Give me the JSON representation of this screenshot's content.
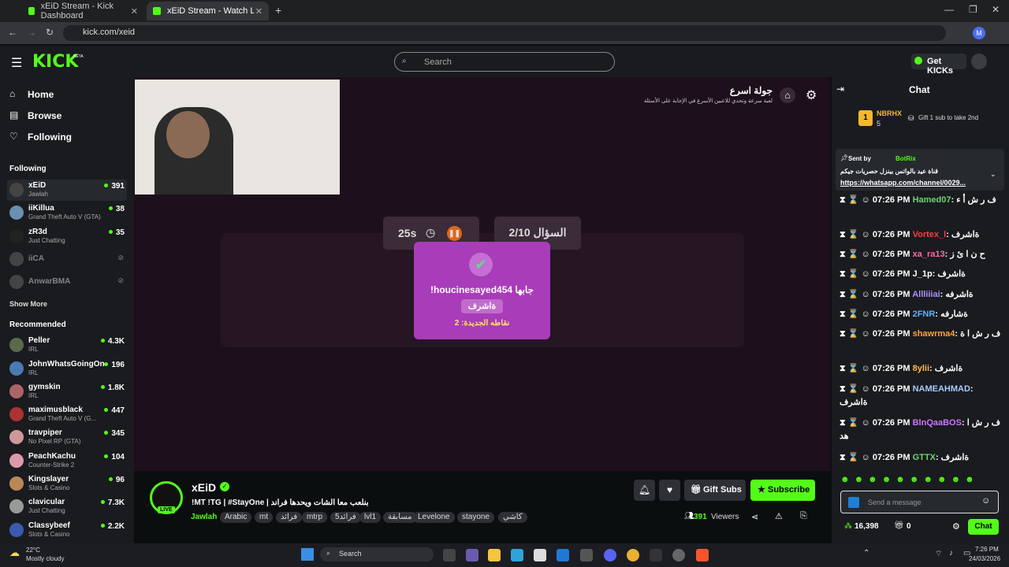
{
  "browser": {
    "tabs": [
      {
        "title": "xEiD Stream - Kick Dashboard"
      },
      {
        "title": "xEiD Stream - Watch Live o"
      }
    ],
    "url": "kick.com/xeid",
    "profile_initial": "M"
  },
  "header": {
    "logo": "KICK",
    "logo_badge": "BETA",
    "search_placeholder": "Search",
    "get_kicks": "Get KICKs"
  },
  "sidebar": {
    "nav": [
      {
        "label": "Home",
        "icon": "home-icon"
      },
      {
        "label": "Browse",
        "icon": "compass-icon"
      },
      {
        "label": "Following",
        "icon": "heart-icon"
      }
    ],
    "following_title": "Following",
    "following": [
      {
        "name": "xEiD",
        "category": "Jawlah",
        "viewers": "391"
      },
      {
        "name": "iiKillua",
        "category": "Grand Theft Auto V (GTA)",
        "viewers": "38"
      },
      {
        "name": "zR3d",
        "category": "Just Chatting",
        "viewers": "35"
      },
      {
        "name": "iiCA",
        "category": "",
        "viewers": ""
      },
      {
        "name": "AnwarBMA",
        "category": "",
        "viewers": ""
      }
    ],
    "show_more": "Show More",
    "recommended_title": "Recommended",
    "recommended": [
      {
        "name": "Peller",
        "category": "IRL",
        "viewers": "4.3K"
      },
      {
        "name": "JohnWhatsGoingOn",
        "category": "IRL",
        "viewers": "196"
      },
      {
        "name": "gymskin",
        "category": "IRL",
        "viewers": "1.8K"
      },
      {
        "name": "maximusblack",
        "category": "Grand Theft Auto V (G...",
        "viewers": "447"
      },
      {
        "name": "travpiper",
        "category": "No Pixel RP (GTA)",
        "viewers": "345"
      },
      {
        "name": "PeachKachu",
        "category": "Counter-Strike 2",
        "viewers": "104"
      },
      {
        "name": "Kingslayer",
        "category": "Slots & Casino",
        "viewers": "96"
      },
      {
        "name": "clavicular",
        "category": "Just Chatting",
        "viewers": "7.3K"
      },
      {
        "name": "Classybeef",
        "category": "Slots & Casino",
        "viewers": "2.2K"
      }
    ]
  },
  "game": {
    "title": "جولة اسرع",
    "subtitle": "لعبة سرعة وتحدي للاعبين الأسرع في الإجابة على الأسئلة",
    "timer": "25s",
    "question_counter": "السؤال 2/10",
    "popup_title": "!houcinesayed454 جابها",
    "popup_answer": "ةاشرف",
    "popup_points": "نقاطه الجديدة: 2"
  },
  "stream": {
    "streamer": "xEiD",
    "live_label": "LIVE",
    "stream_title": "!MT !TG | #StayOne | بنلعب معا الشات ويحدها فراند",
    "category": "Jawlah",
    "tags": [
      "Arabic",
      "mt",
      "فرائد",
      "mtrp",
      "فرائد5",
      "lvl1",
      "مسابقة",
      "Levelone",
      "stayone",
      "كاشي"
    ],
    "gift_subs": "Gift Subs",
    "subscribe": "Subscribe",
    "viewers": "391",
    "viewers_label": "Viewers"
  },
  "chat": {
    "title": "Chat",
    "leader_name": "NBRHX",
    "leader_rank": "1",
    "leader_count": "5",
    "gift_prompt": "Gift 1 sub to take 2nd",
    "pinned_sent_by": "Sent by",
    "pinned_author": "BotRix",
    "pinned_text": "قناة عيد بالواتس بينزل حصريات جيكم",
    "pinned_link": "https://whatsapp.com/channel/0029...",
    "messages": [
      {
        "time": "07:26 PM",
        "user": "Hamed07",
        "color": "#6fd36f",
        "text": "ف ر ش أ ء"
      },
      {
        "time": "07:26 PM",
        "user": "Vortex_l",
        "color": "#ff3c3c",
        "text": "ةاشرف"
      },
      {
        "time": "07:26 PM",
        "user": "xa_ra13",
        "color": "#ff6ba8",
        "text": "ح ن ا ئ ز"
      },
      {
        "time": "07:26 PM",
        "user": "J_1p",
        "color": "#fff",
        "text": "ةاشرف"
      },
      {
        "time": "07:26 PM",
        "user": "Allliiiai",
        "color": "#b08cff",
        "text": "ةاشرفه"
      },
      {
        "time": "07:26 PM",
        "user": "2FNR",
        "color": "#5ab4ff",
        "text": "ةشارفه"
      },
      {
        "time": "07:26 PM",
        "user": "shawrma4",
        "color": "#ffa23c",
        "text": "ف ر ش ا ة"
      },
      {
        "time": "07:26 PM",
        "user": "8ylii",
        "color": "#ffb84d",
        "text": "ةاشرف"
      },
      {
        "time": "07:26 PM",
        "user": "NAMEAHMAD",
        "color": "#a8c8ff",
        "text": "ةاشرف"
      },
      {
        "time": "07:26 PM",
        "user": "BlnQaaBOS",
        "color": "#c878ff",
        "text": "ف ر ش ا هد"
      },
      {
        "time": "07:26 PM",
        "user": "GTTX",
        "color": "#6fd36f",
        "text": "ةاشرف"
      }
    ],
    "input_placeholder": "Send a message",
    "points": "16,398",
    "count": "0",
    "send_label": "Chat"
  },
  "taskbar": {
    "temp": "22°C",
    "weather": "Mostly cloudy",
    "search": "Search",
    "time": "7:26 PM",
    "date": "24/03/2026"
  }
}
